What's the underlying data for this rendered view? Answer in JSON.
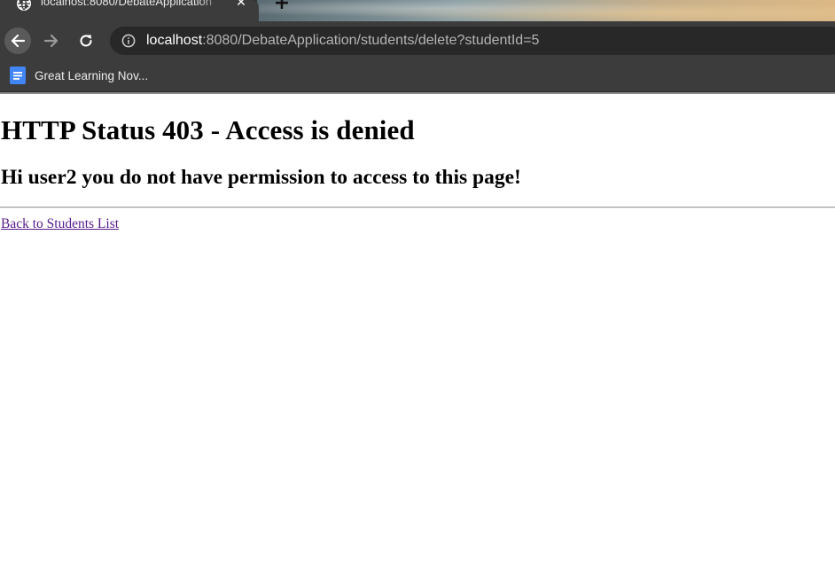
{
  "browser": {
    "tab": {
      "title": "localhost:8080/DebateApplication",
      "favicon": "globe-icon",
      "close_icon": "close-icon"
    },
    "new_tab_icon": "plus-icon",
    "nav": {
      "back_icon": "arrow-left-icon",
      "forward_icon": "arrow-right-icon",
      "reload_icon": "reload-icon"
    },
    "address_bar": {
      "security_icon": "info-icon",
      "host": "localhost",
      "path": ":8080/DebateApplication/students/delete?studentId=5"
    },
    "bookmarks": [
      {
        "label": "Great Learning Nov...",
        "icon": "google-docs-icon"
      }
    ]
  },
  "page": {
    "heading": "HTTP Status 403 - Access is denied",
    "message": "Hi user2 you do not have permission to access to this page!",
    "back_link": "Back to Students List"
  },
  "colors": {
    "chrome_background": "#3c3c3c",
    "omnibox_background": "#282828",
    "link_visited": "#551a8b",
    "docs_icon_blue": "#4285f4"
  }
}
